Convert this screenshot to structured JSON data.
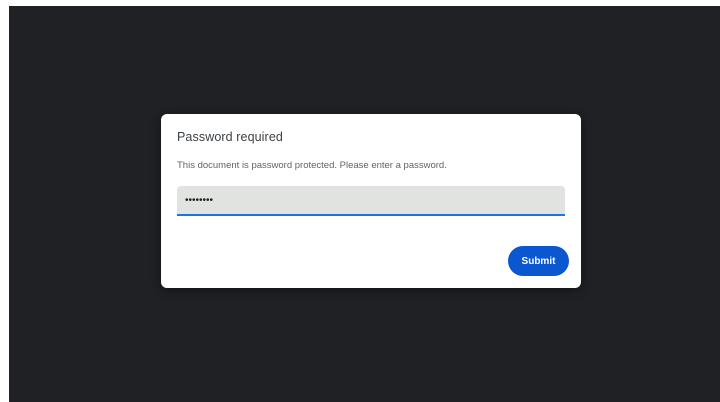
{
  "dialog": {
    "title": "Password required",
    "message": "This document is password protected. Please enter a password.",
    "password_value": "••••••••",
    "submit_label": "Submit"
  },
  "colors": {
    "viewer_background": "#202124",
    "dialog_background": "#ffffff",
    "field_background": "#e1e3e1",
    "field_underline": "#1a73e8",
    "submit_button": "#0b57d0"
  }
}
